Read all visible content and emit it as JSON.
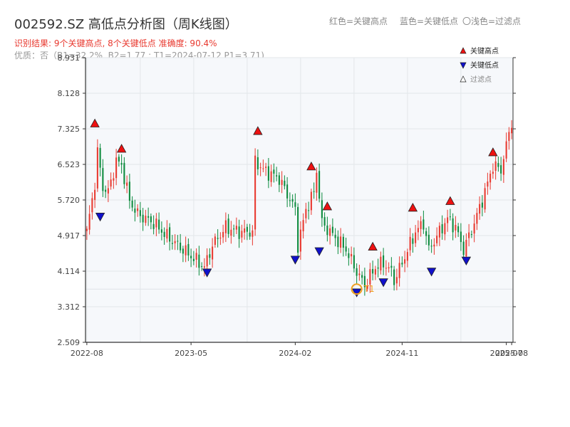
{
  "header": {
    "title": "002592.SZ 高低点分析图（周K线图）",
    "legend_red": "红色=关键高点",
    "legend_blue": "蓝色=关键低点",
    "legend_filter": "〇浅色=过滤点",
    "result_line": "识别结果: 9个关键高点, 8个关键低点  准确度: 90.4%",
    "quality_line": "优质：否（B1=32.2%, B2=1.77 ; T1=2024-07-12 P1=3.71)"
  },
  "colors": {
    "up": "#e8392f",
    "down": "#0b8a3c",
    "high_marker": "#ee1111",
    "low_marker": "#1010cc",
    "t1": "#f0a020",
    "plot_bg": "#f6f8fb"
  },
  "chart_data": {
    "type": "candlestick",
    "ylim": [
      2.509,
      8.931
    ],
    "y_ticks": [
      "2.509",
      "3.312",
      "4.114",
      "4.917",
      "5.720",
      "6.523",
      "7.325",
      "8.128",
      "8.931"
    ],
    "x_ticks": [
      "2022-08",
      "2023-05",
      "2024-02",
      "2024-11",
      "2025-07",
      "2025-08"
    ],
    "x_tick_weeks": [
      0,
      39,
      78,
      118,
      157,
      159
    ],
    "n_weeks": 160,
    "close_anchors": [
      [
        0,
        5.0
      ],
      [
        3,
        6.1
      ],
      [
        4,
        6.8
      ],
      [
        6,
        6.0
      ],
      [
        8,
        5.9
      ],
      [
        11,
        6.6
      ],
      [
        13,
        6.5
      ],
      [
        16,
        5.7
      ],
      [
        19,
        5.4
      ],
      [
        25,
        5.2
      ],
      [
        30,
        4.9
      ],
      [
        36,
        4.6
      ],
      [
        44,
        4.2
      ],
      [
        47,
        4.7
      ],
      [
        52,
        5.1
      ],
      [
        57,
        5.0
      ],
      [
        62,
        5.0
      ],
      [
        63,
        6.6
      ],
      [
        66,
        6.4
      ],
      [
        72,
        6.2
      ],
      [
        78,
        5.5
      ],
      [
        79,
        4.7
      ],
      [
        82,
        5.5
      ],
      [
        85,
        5.9
      ],
      [
        86,
        6.4
      ],
      [
        88,
        5.2
      ],
      [
        91,
        5.0
      ],
      [
        94,
        4.8
      ],
      [
        97,
        4.6
      ],
      [
        101,
        4.1
      ],
      [
        104,
        3.8
      ],
      [
        108,
        4.2
      ],
      [
        111,
        4.3
      ],
      [
        114,
        4.1
      ],
      [
        115,
        3.9
      ],
      [
        118,
        4.3
      ],
      [
        123,
        5.0
      ],
      [
        126,
        5.2
      ],
      [
        128,
        4.6
      ],
      [
        132,
        5.0
      ],
      [
        135,
        5.3
      ],
      [
        138,
        5.1
      ],
      [
        141,
        4.6
      ],
      [
        145,
        5.2
      ],
      [
        149,
        5.9
      ],
      [
        152,
        6.5
      ],
      [
        155,
        6.4
      ],
      [
        159,
        7.5
      ]
    ],
    "key_highs": [
      {
        "week": 3,
        "price": 7.35
      },
      {
        "week": 13,
        "price": 6.78
      },
      {
        "week": 64,
        "price": 7.18
      },
      {
        "week": 84,
        "price": 6.38
      },
      {
        "week": 90,
        "price": 5.48
      },
      {
        "week": 107,
        "price": 4.57
      },
      {
        "week": 122,
        "price": 5.45
      },
      {
        "week": 136,
        "price": 5.6
      },
      {
        "week": 152,
        "price": 6.7
      }
    ],
    "key_lows": [
      {
        "week": 5,
        "price": 5.44
      },
      {
        "week": 45,
        "price": 4.18
      },
      {
        "week": 78,
        "price": 4.47
      },
      {
        "week": 87,
        "price": 4.66
      },
      {
        "week": 101,
        "price": 3.73
      },
      {
        "week": 111,
        "price": 3.96
      },
      {
        "week": 129,
        "price": 4.2
      },
      {
        "week": 142,
        "price": 4.45
      }
    ],
    "t1": {
      "week": 101,
      "price": 3.71,
      "label": "T1"
    },
    "legend_box": [
      "关键高点",
      "关键低点",
      "过滤点"
    ]
  }
}
